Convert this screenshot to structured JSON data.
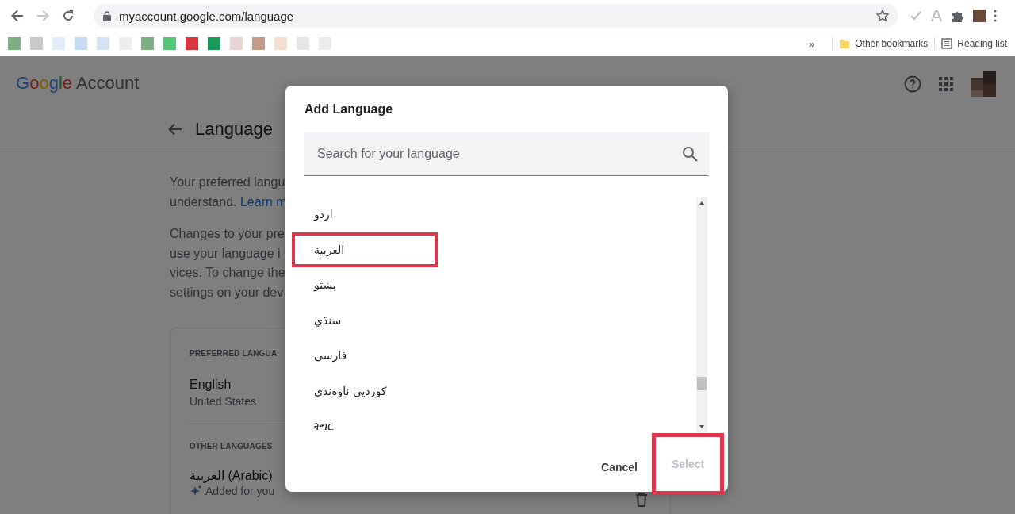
{
  "browser": {
    "back_enabled": true,
    "forward_enabled": false,
    "url": "myaccount.google.com/language",
    "bookmarks": [
      {
        "color": "#7fae85"
      },
      {
        "color": "#c9c9c9"
      },
      {
        "color": "#e3ecf8"
      },
      {
        "color": "#c6dcf3"
      },
      {
        "color": "#d7e3f5"
      },
      {
        "color": "#eeeeee"
      },
      {
        "color": "#7fae85"
      },
      {
        "color": "#52c77a"
      },
      {
        "color": "#d9363e"
      },
      {
        "color": "#1a9a5a"
      },
      {
        "color": "#e8d5d5"
      },
      {
        "color": "#c49a8a"
      },
      {
        "color": "#f3e0d0"
      },
      {
        "color": "#e6e6e6"
      },
      {
        "color": "#ececec"
      }
    ],
    "bookmarks_more": "»",
    "other_bookmarks": "Other bookmarks",
    "reading_list": "Reading list"
  },
  "page": {
    "brand": "Google",
    "product": "Account",
    "title": "Language",
    "intro": [
      {
        "text": "Your preferred langu"
      },
      {
        "text": "understand.",
        "link": "Learn m"
      }
    ],
    "changes": [
      "Changes to your pre",
      "use your language i",
      "vices. To change the",
      "settings on your dev"
    ],
    "preferred_heading": "PREFERRED LANGUA",
    "preferred": {
      "name": "English",
      "region": "United States"
    },
    "other_heading": "OTHER LANGUAGES",
    "other": [
      {
        "name": "العربية (Arabic)",
        "note": "Added for you"
      }
    ]
  },
  "dialog": {
    "title": "Add Language",
    "search": {
      "placeholder": "Search for your language"
    },
    "languages": [
      {
        "name": "اردو",
        "highlighted": false
      },
      {
        "name": "العربية",
        "highlighted": true
      },
      {
        "name": "پښتو",
        "highlighted": false
      },
      {
        "name": "سنڌي",
        "highlighted": false
      },
      {
        "name": "فارسی",
        "highlighted": false
      },
      {
        "name": "کوردیی ناوەندی",
        "highlighted": false
      },
      {
        "name": "ትግር",
        "highlighted": false
      }
    ],
    "cancel": {
      "label": "Cancel"
    },
    "select": {
      "label": "Select",
      "disabled": true,
      "highlighted": true
    }
  }
}
